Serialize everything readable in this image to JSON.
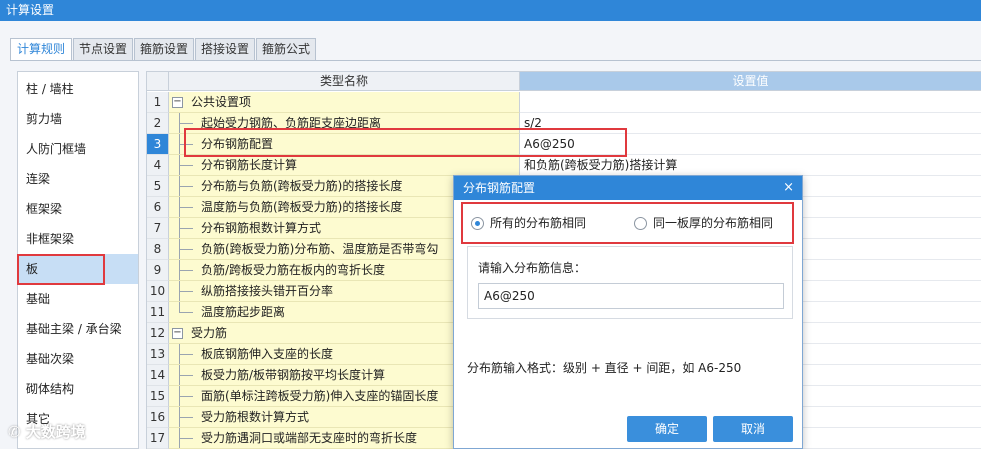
{
  "window": {
    "title": "计算设置"
  },
  "tabs": [
    {
      "label": "计算规则",
      "active": true
    },
    {
      "label": "节点设置",
      "active": false
    },
    {
      "label": "箍筋设置",
      "active": false
    },
    {
      "label": "搭接设置",
      "active": false
    },
    {
      "label": "箍筋公式",
      "active": false
    }
  ],
  "sidebar": {
    "items": [
      {
        "label": "柱 / 墙柱"
      },
      {
        "label": "剪力墙"
      },
      {
        "label": "人防门框墙"
      },
      {
        "label": "连梁"
      },
      {
        "label": "框架梁"
      },
      {
        "label": "非框架梁"
      },
      {
        "label": "板",
        "selected": true
      },
      {
        "label": "基础"
      },
      {
        "label": "基础主梁 / 承台梁"
      },
      {
        "label": "基础次梁"
      },
      {
        "label": "砌体结构"
      },
      {
        "label": "其它"
      }
    ]
  },
  "grid": {
    "header": {
      "name": "类型名称",
      "value": "设置值"
    },
    "rows": [
      {
        "num": "1",
        "name": "公共设置项",
        "value": "",
        "group": true,
        "expander": "−"
      },
      {
        "num": "2",
        "name": "起始受力钢筋、负筋距支座边距离",
        "value": "s/2"
      },
      {
        "num": "3",
        "name": "分布钢筋配置",
        "value": "A6@250",
        "selected": true
      },
      {
        "num": "4",
        "name": "分布钢筋长度计算",
        "value": "和负筋(跨板受力筋)搭接计算"
      },
      {
        "num": "5",
        "name": "分布筋与负筋(跨板受力筋)的搭接长度",
        "value": ""
      },
      {
        "num": "6",
        "name": "温度筋与负筋(跨板受力筋)的搭接长度",
        "value": ""
      },
      {
        "num": "7",
        "name": "分布钢筋根数计算方式",
        "value": ""
      },
      {
        "num": "8",
        "name": "负筋(跨板受力筋)分布筋、温度筋是否带弯勾",
        "value": ""
      },
      {
        "num": "9",
        "name": "负筋/跨板受力筋在板内的弯折长度",
        "value": ""
      },
      {
        "num": "10",
        "name": "纵筋搭接接头错开百分率",
        "value": ""
      },
      {
        "num": "11",
        "name": "温度筋起步距离",
        "value": ""
      },
      {
        "num": "12",
        "name": "受力筋",
        "value": "",
        "group": true,
        "expander": "−"
      },
      {
        "num": "13",
        "name": "板底钢筋伸入支座的长度",
        "value": ""
      },
      {
        "num": "14",
        "name": "板受力筋/板带钢筋按平均长度计算",
        "value": ""
      },
      {
        "num": "15",
        "name": "面筋(单标注跨板受力筋)伸入支座的锚固长度",
        "value": ""
      },
      {
        "num": "16",
        "name": "受力筋根数计算方式",
        "value": ""
      },
      {
        "num": "17",
        "name": "受力筋遇洞口或端部无支座时的弯折长度",
        "value": ""
      }
    ]
  },
  "dialog": {
    "title": "分布钢筋配置",
    "close_icon": "×",
    "option_all": "所有的分布筋相同",
    "option_same_thickness": "同一板厚的分布筋相同",
    "selected_option": "option_all",
    "field_label": "请输入分布筋信息：",
    "field_value": "A6@250",
    "format_hint": "分布筋输入格式：级别 + 直径 + 间距，如 A6-250",
    "ok_label": "确定",
    "cancel_label": "取消"
  },
  "watermark": {
    "text": "大数跨境"
  },
  "colors": {
    "accent": "#2f86d8",
    "highlight_box": "#e0393e",
    "row_name_bg": "#fdfbd0",
    "selected_sidebar_bg": "#c7def5"
  }
}
